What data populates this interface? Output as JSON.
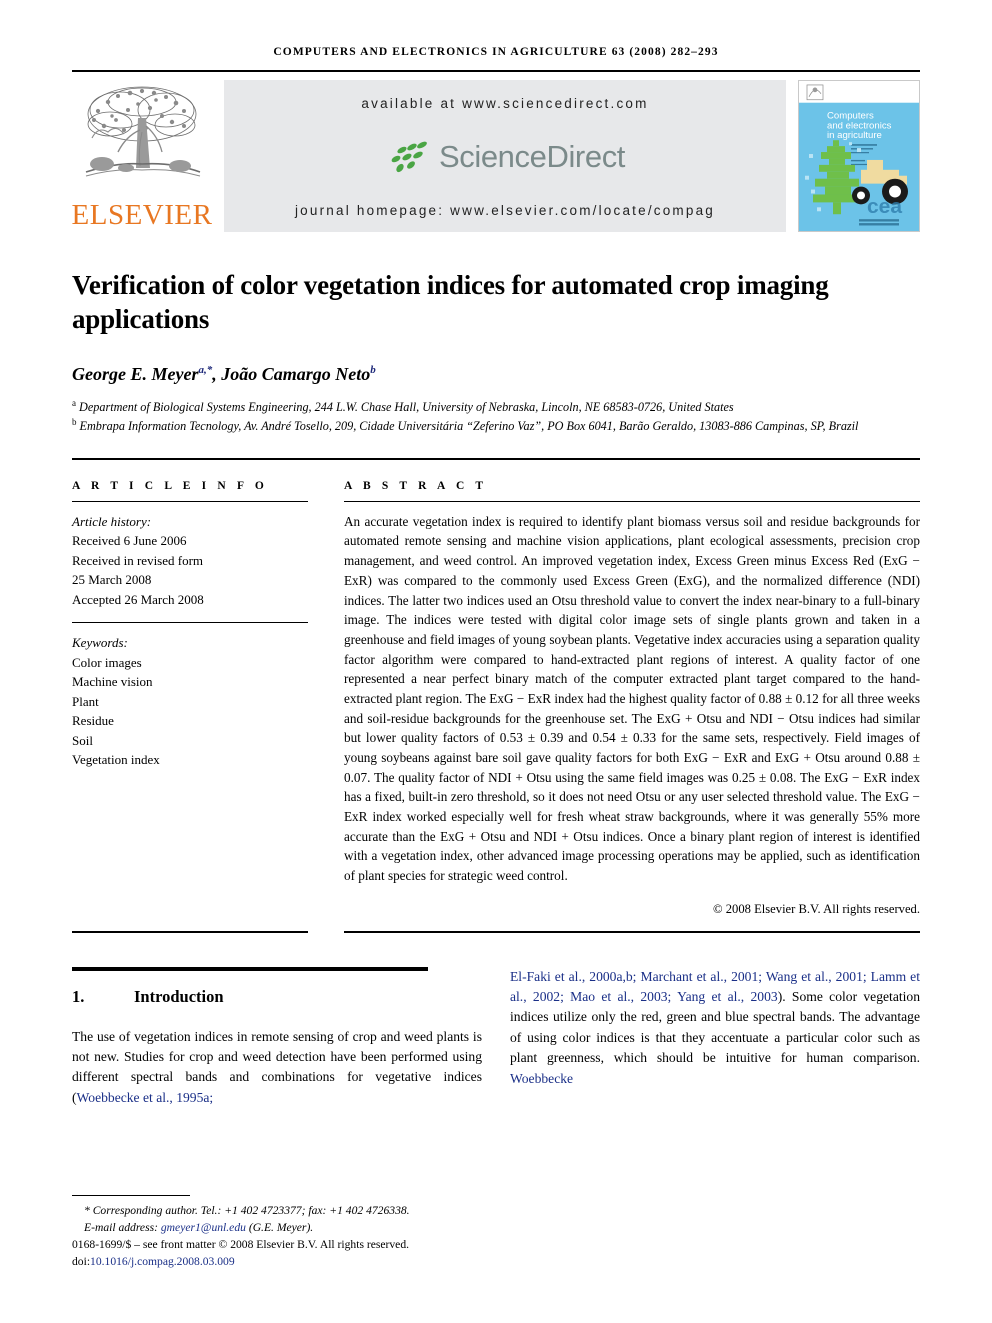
{
  "running_head": "COMPUTERS AND ELECTRONICS IN AGRICULTURE 63 (2008) 282–293",
  "masthead": {
    "publisher_name": "ELSEVIER",
    "available_at": "available at www.sciencedirect.com",
    "sciencedirect_word": "ScienceDirect",
    "journal_homepage": "journal homepage: www.elsevier.com/locate/compag",
    "cover": {
      "line1": "Computers",
      "line2": "and electronics",
      "line3": "in agriculture",
      "logo_text": "cea",
      "background_color": "#6cc3e8",
      "tree_color": "#6fbf4a",
      "tractor_color": "#f0dba0"
    },
    "colors": {
      "elsevier_orange": "#E87722",
      "band_gray": "#e7e8ea",
      "sciencedirect_gray": "#7b8a8a",
      "leaf_green": "#4aa544"
    }
  },
  "article": {
    "title": "Verification of color vegetation indices for automated crop imaging applications",
    "authors": [
      {
        "name": "George E. Meyer",
        "sup": "a,*"
      },
      {
        "name": "João Camargo Neto",
        "sup": "b"
      }
    ],
    "affiliations": [
      {
        "marker": "a",
        "text": "Department of Biological Systems Engineering, 244 L.W. Chase Hall, University of Nebraska, Lincoln, NE 68583-0726, United States"
      },
      {
        "marker": "b",
        "text": "Embrapa Information Tecnology, Av. André Tosello, 209, Cidade Universitária “Zeferino Vaz”, PO Box 6041, Barão Geraldo, 13083-886 Campinas, SP, Brazil"
      }
    ]
  },
  "article_info": {
    "heading": "A R T I C L E   I N F O",
    "history_label": "Article history:",
    "history": [
      "Received 6 June 2006",
      "Received in revised form",
      "25 March 2008",
      "Accepted 26 March 2008"
    ],
    "keywords_label": "Keywords:",
    "keywords": [
      "Color images",
      "Machine vision",
      "Plant",
      "Residue",
      "Soil",
      "Vegetation index"
    ]
  },
  "abstract": {
    "heading": "A B S T R A C T",
    "text": "An accurate vegetation index is required to identify plant biomass versus soil and residue backgrounds for automated remote sensing and machine vision applications, plant ecological assessments, precision crop management, and weed control. An improved vegetation index, Excess Green minus Excess Red (ExG − ExR) was compared to the commonly used Excess Green (ExG), and the normalized difference (NDI) indices. The latter two indices used an Otsu threshold value to convert the index near-binary to a full-binary image. The indices were tested with digital color image sets of single plants grown and taken in a greenhouse and field images of young soybean plants. Vegetative index accuracies using a separation quality factor algorithm were compared to hand-extracted plant regions of interest. A quality factor of one represented a near perfect binary match of the computer extracted plant target compared to the hand-extracted plant region. The ExG − ExR index had the highest quality factor of 0.88 ± 0.12 for all three weeks and soil-residue backgrounds for the greenhouse set. The ExG + Otsu and NDI − Otsu indices had similar but lower quality factors of 0.53 ± 0.39 and 0.54 ± 0.33 for the same sets, respectively. Field images of young soybeans against bare soil gave quality factors for both ExG − ExR and ExG + Otsu around 0.88 ± 0.07. The quality factor of NDI + Otsu using the same field images was 0.25 ± 0.08. The ExG − ExR index has a fixed, built-in zero threshold, so it does not need Otsu or any user selected threshold value. The ExG − ExR index worked especially well for fresh wheat straw backgrounds, where it was generally 55% more accurate than the ExG + Otsu and NDI + Otsu indices. Once a binary plant region of interest is identified with a vegetation index, other advanced image processing operations may be applied, such as identification of plant species for strategic weed control.",
    "copyright": "© 2008 Elsevier B.V. All rights reserved."
  },
  "introduction": {
    "number": "1.",
    "heading": "Introduction",
    "col1_text_before_cite": "The use of vegetation indices in remote sensing of crop and weed plants is not new. Studies for crop and weed detection have been performed using different spectral bands and combinations for vegetative indices (",
    "col1_cite": "Woebbecke et al., 1995a;",
    "col2_cite": "El-Faki et al., 2000a,b; Marchant et al., 2001; Wang et al., 2001; Lamm et al., 2002; Mao et al., 2003; Yang et al., 2003",
    "col2_text_after_cite": "). Some color vegetation indices utilize only the red, green and blue spectral bands. The advantage of using color indices is that they accentuate a particular color such as plant greenness, which should be intuitive for human comparison. ",
    "col2_cite_tail": "Woebbecke"
  },
  "footnotes": {
    "corresponding": "* Corresponding author. Tel.: +1 402 4723377; fax: +1 402 4726338.",
    "email_label": "E-mail address:",
    "email": "gmeyer1@unl.edu",
    "email_attrib": "(G.E. Meyer).",
    "front_matter": "0168-1699/$ – see front matter © 2008 Elsevier B.V. All rights reserved.",
    "doi_label": "doi:",
    "doi_value": "10.1016/j.compag.2008.03.009"
  }
}
